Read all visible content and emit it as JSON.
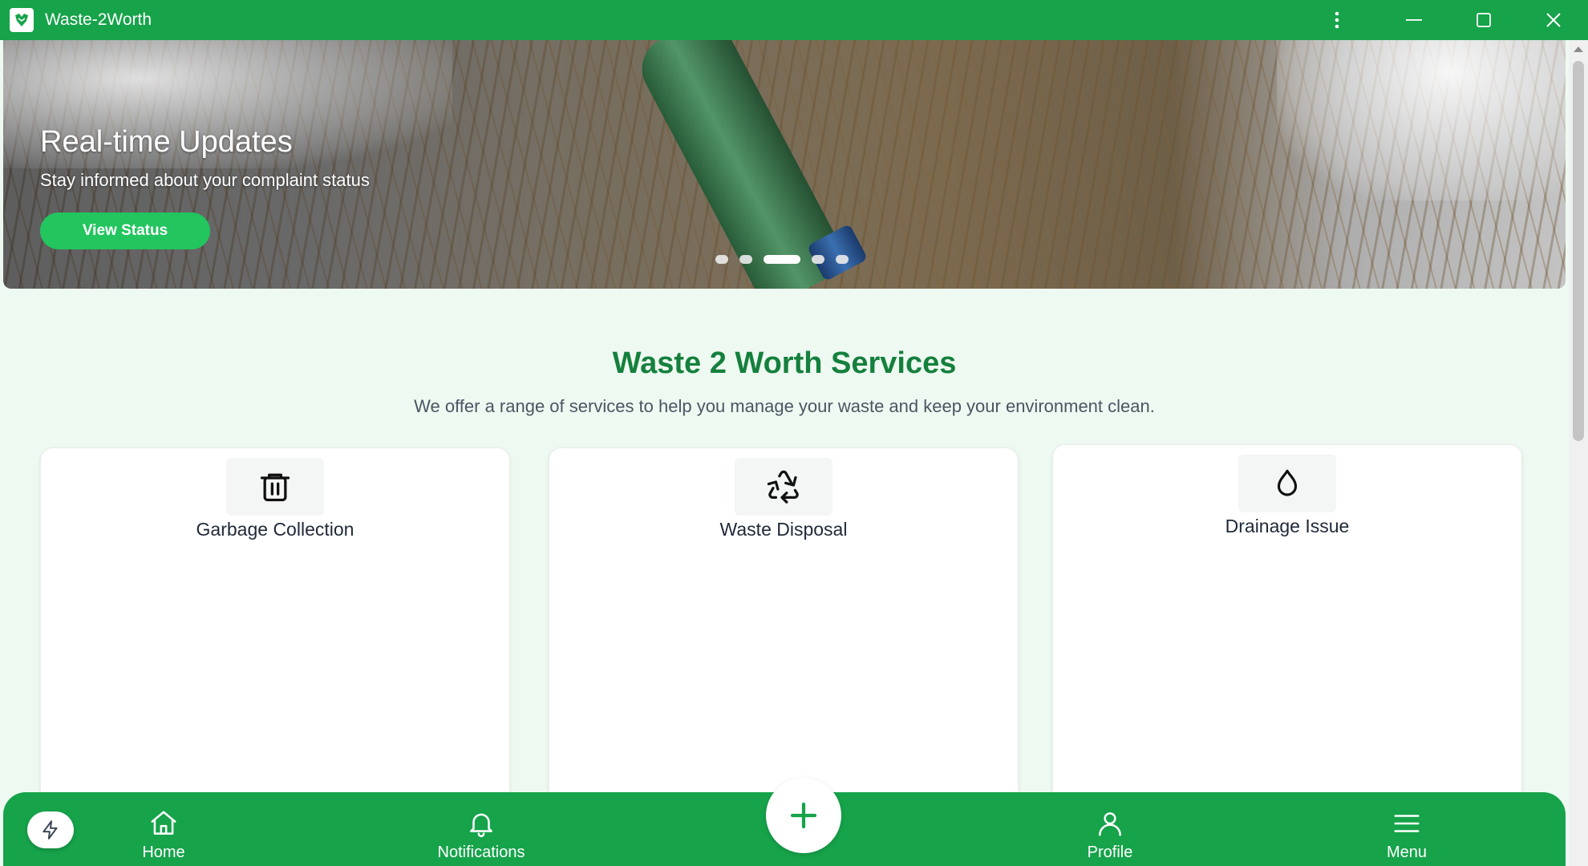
{
  "window": {
    "title": "Waste-2Worth"
  },
  "hero": {
    "title": "Real-time Updates",
    "subtitle": "Stay informed about your complaint status",
    "button_label": "View Status",
    "slide_count": 5,
    "active_slide": 3
  },
  "services": {
    "title": "Waste 2 Worth Services",
    "subtitle": "We offer a range of services to help you manage your waste and keep your environment clean.",
    "cards": [
      {
        "label": "Garbage Collection",
        "icon": "trash-icon"
      },
      {
        "label": "Waste Disposal",
        "icon": "recycle-icon"
      },
      {
        "label": "Drainage Issue",
        "icon": "droplet-icon"
      }
    ]
  },
  "nav": {
    "items": [
      {
        "label": "Home",
        "icon": "home-icon"
      },
      {
        "label": "Notifications",
        "icon": "bell-icon"
      },
      {
        "label": "Add",
        "icon": "plus-icon"
      },
      {
        "label": "Profile",
        "icon": "user-icon"
      },
      {
        "label": "Menu",
        "icon": "hamburger-icon"
      }
    ]
  },
  "colors": {
    "primary": "#16a34a",
    "accent": "#22c55e",
    "title_green": "#15803d",
    "background": "#eefaf1"
  }
}
